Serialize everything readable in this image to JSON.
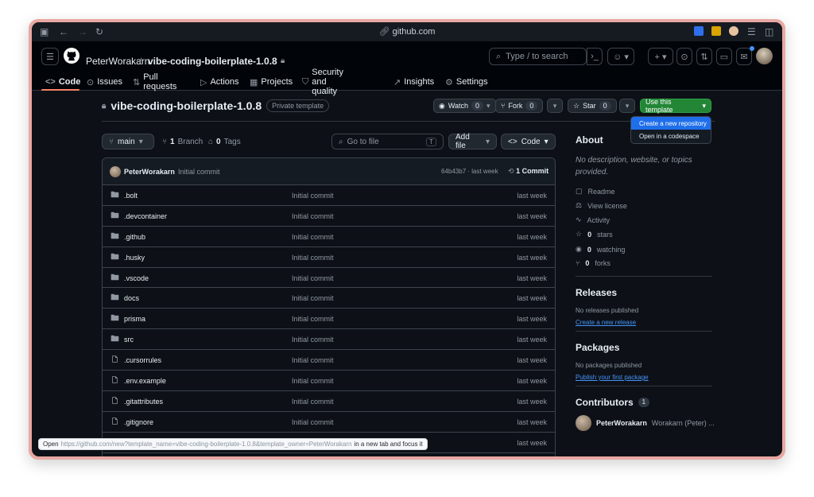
{
  "browser": {
    "url": "github.com"
  },
  "header": {
    "owner": "PeterWorakarn",
    "separator": "/",
    "repo": "vibe-coding-boilerplate-1.0.8",
    "search_placeholder": "Type / to search",
    "search_key": "/"
  },
  "tabs": [
    {
      "label": "Code"
    },
    {
      "label": "Issues"
    },
    {
      "label": "Pull requests"
    },
    {
      "label": "Actions"
    },
    {
      "label": "Projects"
    },
    {
      "label": "Security and quality"
    },
    {
      "label": "Insights"
    },
    {
      "label": "Settings"
    }
  ],
  "repo": {
    "title": "vibe-coding-boilerplate-1.0.8",
    "badge": "Private template",
    "watch": {
      "label": "Watch",
      "count": "0"
    },
    "fork": {
      "label": "Fork",
      "count": "0"
    },
    "star": {
      "label": "Star",
      "count": "0"
    },
    "use_template": "Use this template"
  },
  "dropdown": {
    "items": [
      "Create a new repository",
      "Open in a codespace"
    ]
  },
  "toolbar": {
    "branch": "main",
    "branch_count": "1",
    "branch_label": "Branch",
    "tag_count": "0",
    "tag_label": "Tags",
    "goto_placeholder": "Go to file",
    "goto_key": "T",
    "add_file": "Add file",
    "code": "Code"
  },
  "commit": {
    "author": "PeterWorakarn",
    "message": "Initial commit",
    "hash_time": "64b43b7 · last week",
    "count": "1 Commit"
  },
  "files": [
    {
      "name": ".bolt",
      "type": "folder",
      "msg": "Initial commit",
      "time": "last week"
    },
    {
      "name": ".devcontainer",
      "type": "folder",
      "msg": "Initial commit",
      "time": "last week"
    },
    {
      "name": ".github",
      "type": "folder",
      "msg": "Initial commit",
      "time": "last week"
    },
    {
      "name": ".husky",
      "type": "folder",
      "msg": "Initial commit",
      "time": "last week"
    },
    {
      "name": ".vscode",
      "type": "folder",
      "msg": "Initial commit",
      "time": "last week"
    },
    {
      "name": "docs",
      "type": "folder",
      "msg": "Initial commit",
      "time": "last week"
    },
    {
      "name": "prisma",
      "type": "folder",
      "msg": "Initial commit",
      "time": "last week"
    },
    {
      "name": "src",
      "type": "folder",
      "msg": "Initial commit",
      "time": "last week"
    },
    {
      "name": ".cursorrules",
      "type": "file",
      "msg": "Initial commit",
      "time": "last week"
    },
    {
      "name": ".env.example",
      "type": "file",
      "msg": "Initial commit",
      "time": "last week"
    },
    {
      "name": ".gitattributes",
      "type": "file",
      "msg": "Initial commit",
      "time": "last week"
    },
    {
      "name": ".gitignore",
      "type": "file",
      "msg": "Initial commit",
      "time": "last week"
    },
    {
      "name": "",
      "type": "file",
      "msg": "",
      "time": "last week"
    }
  ],
  "about": {
    "title": "About",
    "description": "No description, website, or topics provided.",
    "readme": "Readme",
    "license": "View license",
    "activity": "Activity",
    "stars_count": "0",
    "stars_label": "stars",
    "watching_count": "0",
    "watching_label": "watching",
    "forks_count": "0",
    "forks_label": "forks"
  },
  "releases": {
    "title": "Releases",
    "empty": "No releases published",
    "link": "Create a new release"
  },
  "packages": {
    "title": "Packages",
    "empty": "No packages published",
    "link": "Publish your first package"
  },
  "contributors": {
    "title": "Contributors",
    "count": "1",
    "name": "PeterWorakarn",
    "fullname": "Worakarn (Peter) ..."
  },
  "tooltip": {
    "prefix": "Open",
    "url": "https://github.com/new?template_name=vibe-coding-boilerplate-1.0.8&template_owner=PeterWorakarn",
    "suffix": "in a new tab and focus it"
  },
  "colors": {
    "accent": "#238636",
    "link": "#4493f8",
    "tab_underline": "#f78166",
    "background": "#0d1117"
  }
}
